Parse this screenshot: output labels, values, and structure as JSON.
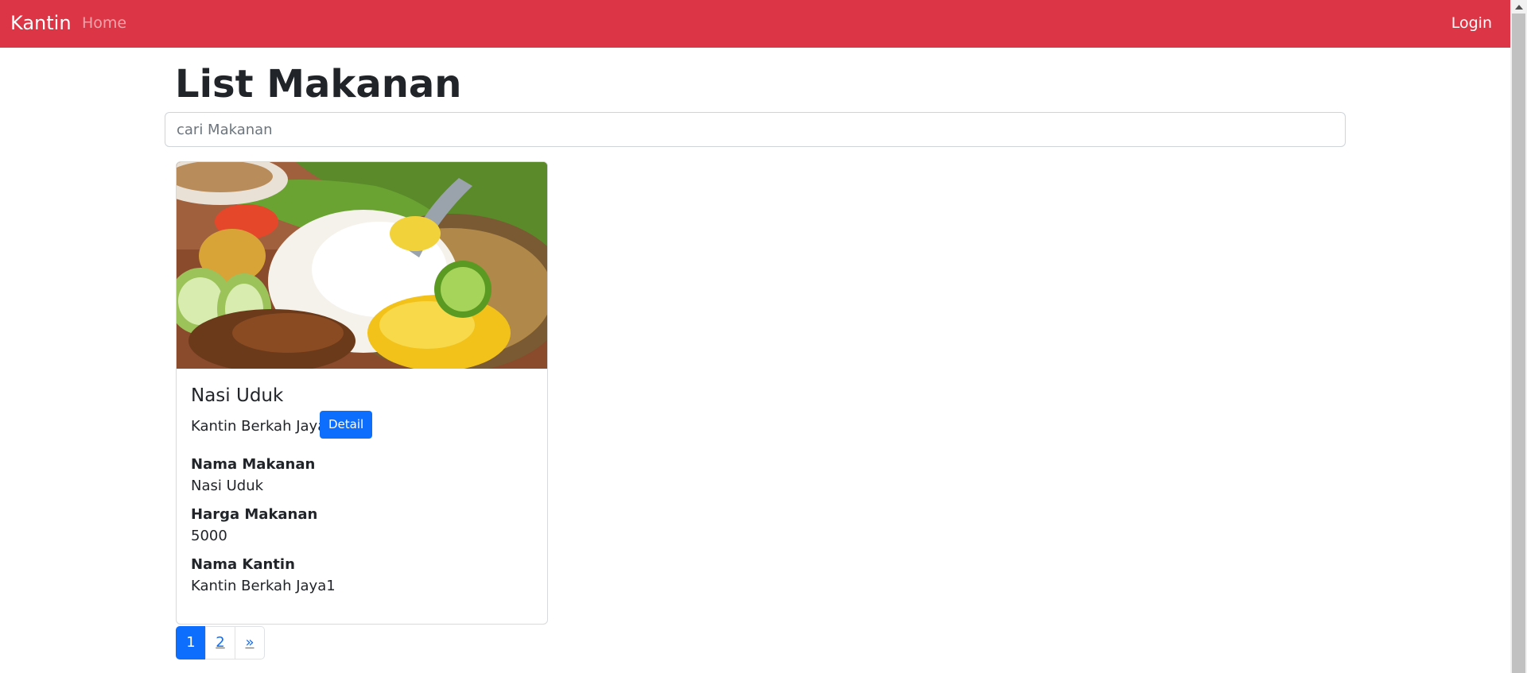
{
  "navbar": {
    "brand": "Kantin",
    "home_label": "Home",
    "login_label": "Login",
    "background_color": "#dc3545"
  },
  "main": {
    "title": "List Makanan",
    "search": {
      "placeholder": "cari Makanan",
      "value": ""
    },
    "cards": [
      {
        "image_alt": "Nasi Uduk",
        "title": "Nasi Uduk",
        "kantin": "Kantin Berkah Jaya1",
        "detail_label": "Detail",
        "fields": [
          {
            "label": "Nama Makanan",
            "value": "Nasi Uduk"
          },
          {
            "label": "Harga Makanan",
            "value": "5000"
          },
          {
            "label": "Nama Kantin",
            "value": "Kantin Berkah Jaya1"
          }
        ]
      }
    ]
  },
  "pagination": {
    "pages": [
      "1",
      "2",
      "»"
    ],
    "active": "1",
    "accent_color": "#0d6efd"
  }
}
